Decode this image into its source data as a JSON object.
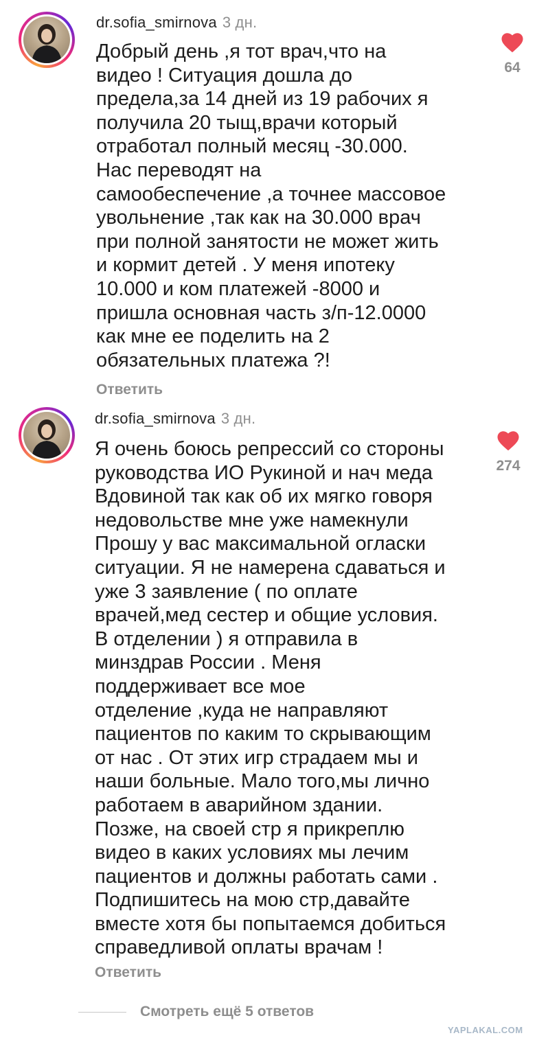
{
  "comments": [
    {
      "username": "dr.sofia_smirnova",
      "time": "3 дн.",
      "text": "Добрый день ,я тот врач,что на\nвидео ! Ситуация дошла до\nпредела,за 14 дней из 19 рабочих я\nполучила 20 тыщ,врачи который\nотработал полный месяц -30.000.\nНас переводят на\nсамообеспечение ,а точнее массовое\nувольнение ,так как на 30.000 врач\nпри полной занятости не может жить\nи кормит детей . У меня ипотеку\n10.000 и ком платежей -8000 и\nпришла основная часть з/п-12.0000\nкак мне ее поделить на 2\nобязательных платежа ?!",
      "reply_label": "Ответить",
      "likes": "64",
      "like_icon": "heart-icon",
      "like_color": "#ed4956"
    },
    {
      "username": "dr.sofia_smirnova",
      "time": "3 дн.",
      "text": "Я очень боюсь репрессий со стороны\nруководства ИО Рукиной и нач меда\nВдовиной так как об их мягко говоря\nнедовольстве мне уже намекнули\nПрошу у вас максимальной огласки\nситуации. Я не намерена сдаваться и\nуже 3 заявление (  по оплате\nврачей,мед сестер и общие условия.\nВ отделении ) я отправила в\nминздрав России . Меня\nподдерживает все мое\nотделение ,куда не направляют\nпациентов по каким то скрывающим\nот нас . От этих игр страдаем мы и\nнаши больные. Мало того,мы лично\nработаем в аварийном здании.\nПозже, на своей стр я прикреплю\nвидео в каких условиях мы  лечим\nпациентов и должны  работать сами .\nПодпишитесь на мою стр,давайте\nвместе хотя бы попытаемся добиться\nсправедливой оплаты  врачам !",
      "reply_label": "Ответить",
      "likes": "274",
      "like_icon": "heart-icon",
      "like_color": "#ed4956"
    }
  ],
  "view_more_replies": "Смотреть ещё 5 ответов",
  "watermark": "YAPLAKAL.COM"
}
